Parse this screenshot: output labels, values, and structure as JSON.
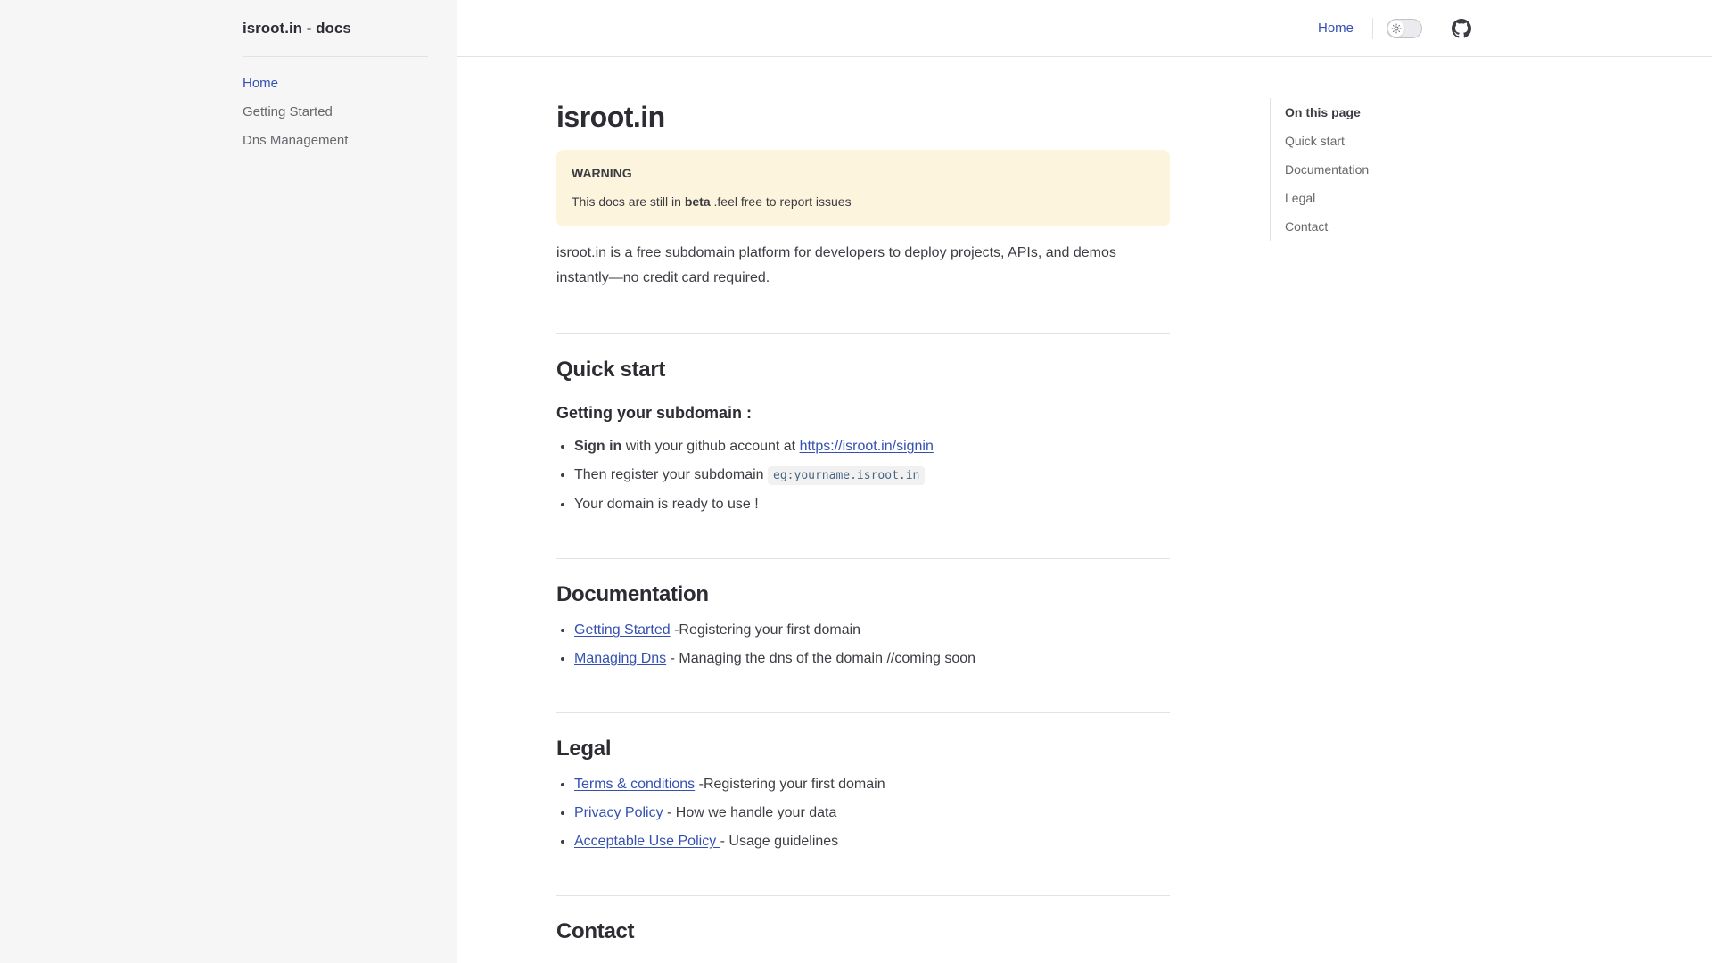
{
  "sidebar": {
    "title": "isroot.in - docs",
    "items": [
      {
        "label": "Home"
      },
      {
        "label": "Getting Started"
      },
      {
        "label": "Dns Management"
      }
    ]
  },
  "topbar": {
    "home_label": "Home",
    "theme_toggle_icon": "sun-icon",
    "github_icon": "github-icon"
  },
  "page": {
    "title": "isroot.in",
    "warning": {
      "title": "WARNING",
      "text_before": "This docs are still in",
      "text_bold": "beta",
      "text_after": ".feel free to report issues"
    },
    "intro": "isroot.in is a free subdomain platform for developers to deploy projects, APIs, and demos instantly—no credit card required.",
    "quick_start": {
      "heading": "Quick start",
      "subheading": "Getting your subdomain :",
      "item1_bold": "Sign in",
      "item1_text": "with your github account at",
      "item1_link": "https://isroot.in/signin",
      "item2_text": "Then register your subdomain",
      "item2_code": "eg:yourname.isroot.in",
      "item3_text": "Your domain is ready to use !"
    },
    "documentation": {
      "heading": "Documentation",
      "items": [
        {
          "link": "Getting Started",
          "text": "-Registering your first domain"
        },
        {
          "link": "Managing Dns",
          "text": "- Managing the dns of the domain //coming soon"
        }
      ]
    },
    "legal": {
      "heading": "Legal",
      "items": [
        {
          "link": "Terms & conditions",
          "text": "-Registering your first domain"
        },
        {
          "link": "Privacy Policy",
          "text": "- How we handle your data"
        },
        {
          "link": "Acceptable Use Policy ",
          "text": "- Usage guidelines"
        }
      ]
    },
    "contact": {
      "heading": "Contact"
    }
  },
  "outline": {
    "title": "On this page",
    "items": [
      {
        "label": "Quick start"
      },
      {
        "label": "Documentation"
      },
      {
        "label": "Legal"
      },
      {
        "label": "Contact"
      }
    ]
  },
  "colors": {
    "brand": "#3451b2",
    "sidebar_bg": "#f6f6f7",
    "warning_bg": "#fcf4dc"
  }
}
